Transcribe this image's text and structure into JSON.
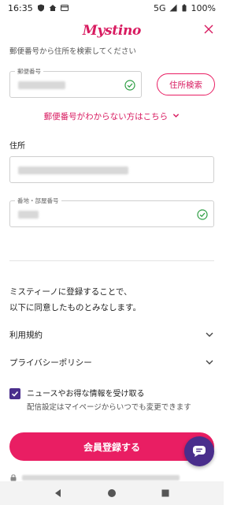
{
  "status_bar": {
    "time": "16:35",
    "network": "5G",
    "battery": "100%"
  },
  "header": {
    "logo": "Mystino",
    "close_icon": "close-icon"
  },
  "form": {
    "hint": "郵便番号から住所を検索してください",
    "postal_code": {
      "label": "郵便番号",
      "value_state": "blurred",
      "validated": true
    },
    "address_search_label": "住所検索",
    "unknown_postal_link": "郵便番号がわからない方はこちら",
    "address": {
      "section_label": "住所",
      "value_state": "blurred"
    },
    "street": {
      "label": "番地・部屋番号",
      "value_state": "blurred",
      "validated": true
    }
  },
  "agreement": {
    "line1": "ミスティーノに登録することで、",
    "line2": "以下に同意したものとみなします。",
    "terms_label": "利用規約",
    "privacy_label": "プライバシーポリシー"
  },
  "newsletter": {
    "checked": true,
    "label": "ニュースやお得な情報を受け取る",
    "sub": "配信設定はマイページからいつでも変更できます"
  },
  "register_button": "会員登録する",
  "colors": {
    "brand": "#d81b60",
    "button": "#e91e63",
    "checkbox": "#4a2e8c",
    "valid": "#2e9e44"
  }
}
